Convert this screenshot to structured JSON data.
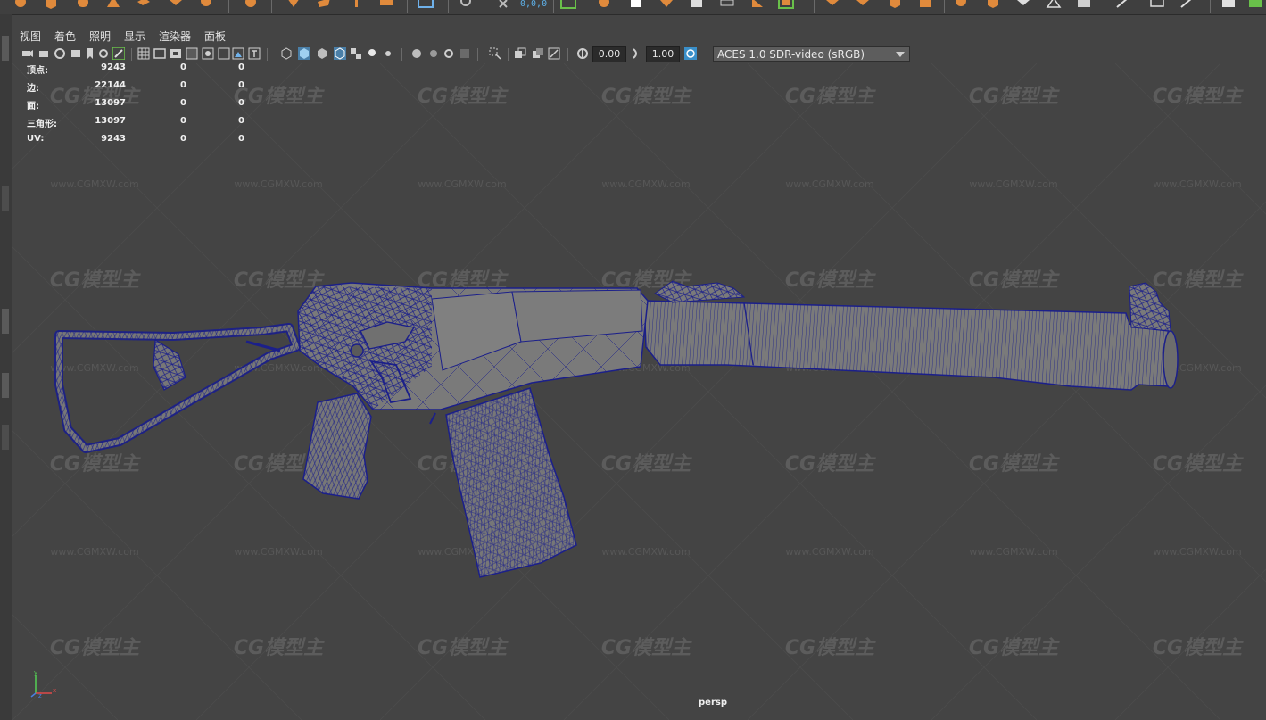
{
  "shelf": {
    "coord_readout": "0,0,0"
  },
  "menubar": {
    "items": [
      "视图",
      "着色",
      "照明",
      "显示",
      "渲染器",
      "面板"
    ]
  },
  "toolbar": {
    "exposure_value": "0.00",
    "gamma_value": "1.00",
    "color_space": "ACES 1.0 SDR-video (sRGB)"
  },
  "hud": {
    "rows": [
      {
        "label": "顶点:",
        "v1": "9243",
        "v2": "0",
        "v3": "0"
      },
      {
        "label": "边:",
        "v1": "22144",
        "v2": "0",
        "v3": "0"
      },
      {
        "label": "面:",
        "v1": "13097",
        "v2": "0",
        "v3": "0"
      },
      {
        "label": "三角形:",
        "v1": "13097",
        "v2": "0",
        "v3": "0"
      },
      {
        "label": "UV:",
        "v1": "9243",
        "v2": "0",
        "v3": "0"
      }
    ]
  },
  "viewport": {
    "camera": "persp",
    "wireframe_color": "#1b1f8a",
    "mesh_fill_color": "#777777"
  },
  "watermark": {
    "logo_text": "CG模型主",
    "url_text": "www.CGMXW.com"
  },
  "axis": {
    "x": "x",
    "y": "y",
    "z": "z"
  }
}
